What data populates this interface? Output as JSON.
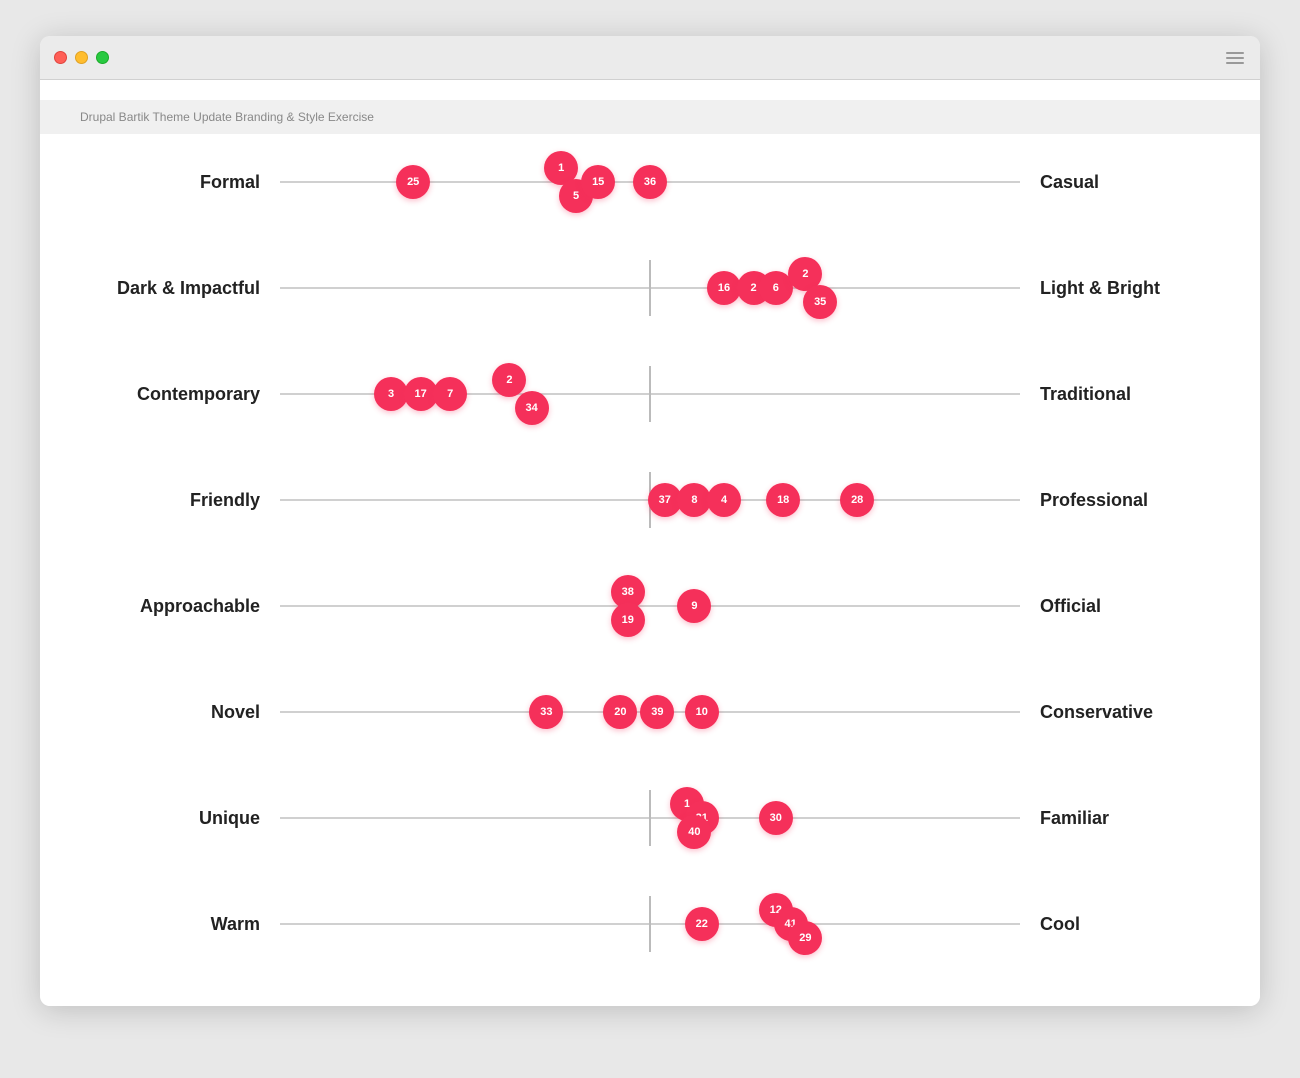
{
  "window": {
    "title": "Drupal Bartik Theme Update Branding & Style Exercise"
  },
  "scales": [
    {
      "id": "formal-casual",
      "left": "Formal",
      "right": "Casual",
      "midline": false,
      "dots": [
        {
          "label": "25",
          "pct": 18
        },
        {
          "label": "1",
          "pct": 38,
          "offsetY": "up"
        },
        {
          "label": "5",
          "pct": 40,
          "offsetY": "down"
        },
        {
          "label": "15",
          "pct": 43
        },
        {
          "label": "36",
          "pct": 50
        }
      ]
    },
    {
      "id": "dark-light",
      "left": "Dark & Impactful",
      "right": "Light & Bright",
      "midline": true,
      "dots": [
        {
          "label": "16",
          "pct": 60
        },
        {
          "label": "2",
          "pct": 64
        },
        {
          "label": "6",
          "pct": 67
        },
        {
          "label": "2",
          "pct": 71,
          "offsetY": "up"
        },
        {
          "label": "35",
          "pct": 73,
          "offsetY": "down"
        }
      ]
    },
    {
      "id": "contemporary-traditional",
      "left": "Contemporary",
      "right": "Traditional",
      "midline": true,
      "dots": [
        {
          "label": "3",
          "pct": 15
        },
        {
          "label": "17",
          "pct": 19
        },
        {
          "label": "7",
          "pct": 23
        },
        {
          "label": "2",
          "pct": 31,
          "offsetY": "up"
        },
        {
          "label": "34",
          "pct": 34,
          "offsetY": "down"
        }
      ]
    },
    {
      "id": "friendly-professional",
      "left": "Friendly",
      "right": "Professional",
      "midline": true,
      "dots": [
        {
          "label": "37",
          "pct": 52
        },
        {
          "label": "8",
          "pct": 56
        },
        {
          "label": "4",
          "pct": 60
        },
        {
          "label": "18",
          "pct": 68
        },
        {
          "label": "28",
          "pct": 78
        }
      ]
    },
    {
      "id": "approachable-official",
      "left": "Approachable",
      "right": "Official",
      "midline": false,
      "dots": [
        {
          "label": "38",
          "pct": 47,
          "offsetY": "up"
        },
        {
          "label": "19",
          "pct": 47,
          "offsetY": "down"
        },
        {
          "label": "9",
          "pct": 56
        }
      ]
    },
    {
      "id": "novel-conservative",
      "left": "Novel",
      "right": "Conservative",
      "midline": false,
      "dots": [
        {
          "label": "33",
          "pct": 36
        },
        {
          "label": "20",
          "pct": 46
        },
        {
          "label": "39",
          "pct": 51
        },
        {
          "label": "10",
          "pct": 57
        }
      ]
    },
    {
      "id": "unique-familiar",
      "left": "Unique",
      "right": "Familiar",
      "midline": true,
      "dots": [
        {
          "label": "1",
          "pct": 55,
          "offsetY": "up"
        },
        {
          "label": "21",
          "pct": 57
        },
        {
          "label": "40",
          "pct": 56,
          "offsetY": "down"
        },
        {
          "label": "30",
          "pct": 67
        }
      ]
    },
    {
      "id": "warm-cool",
      "left": "Warm",
      "right": "Cool",
      "midline": true,
      "dots": [
        {
          "label": "22",
          "pct": 57
        },
        {
          "label": "12",
          "pct": 67,
          "offsetY": "up"
        },
        {
          "label": "41",
          "pct": 69
        },
        {
          "label": "29",
          "pct": 71,
          "offsetY": "down"
        }
      ]
    }
  ]
}
